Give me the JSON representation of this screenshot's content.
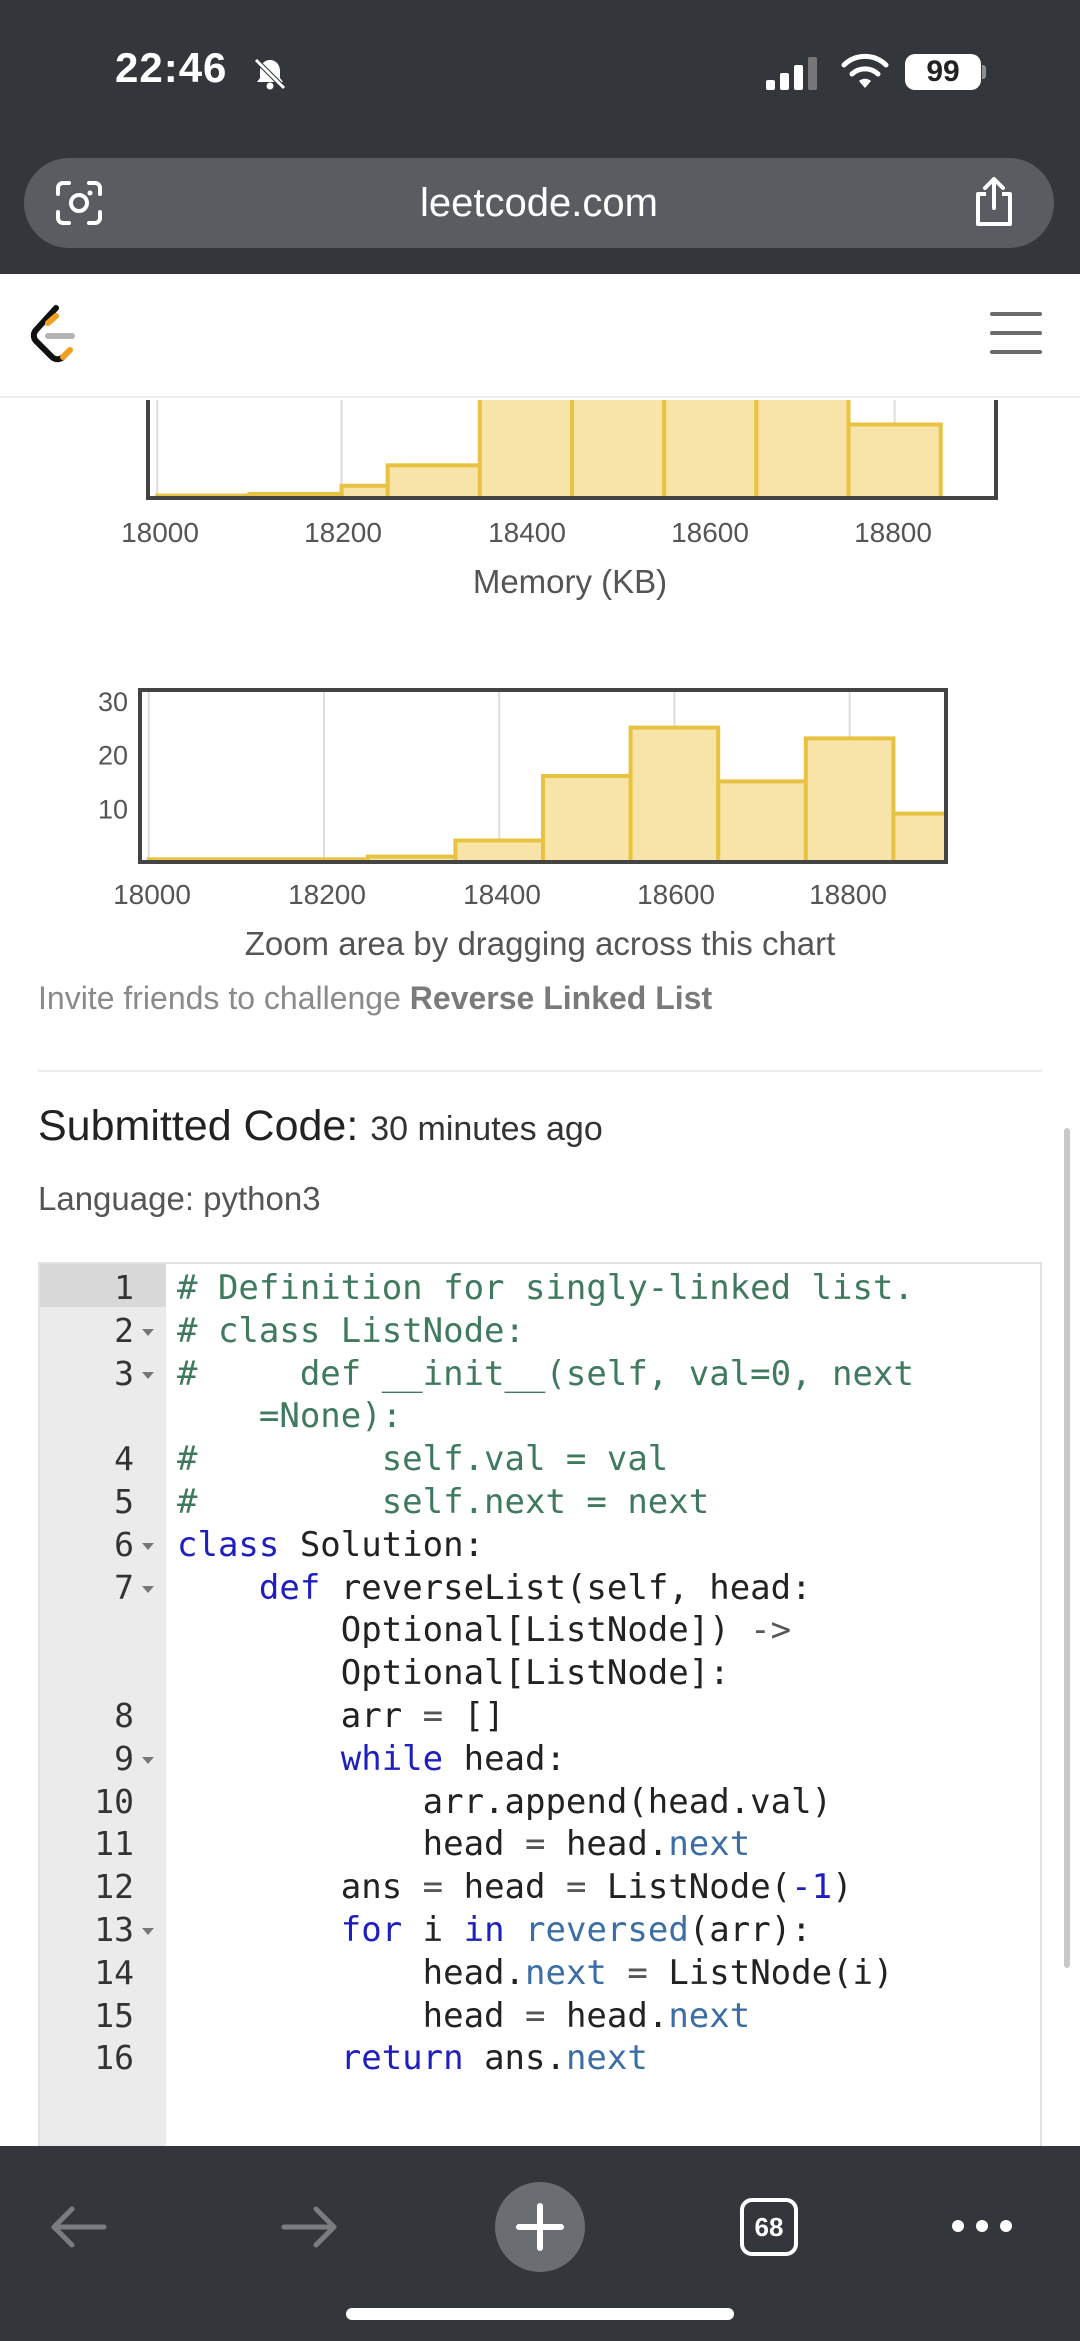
{
  "status_bar": {
    "time": "22:46",
    "battery": "99"
  },
  "browser": {
    "url": "leetcode.com",
    "tab_count": "68"
  },
  "memory_chart": {
    "xlabel": "Memory (KB)"
  },
  "zoom_chart": {
    "hint": "Zoom area by dragging across this chart"
  },
  "chart_data": [
    {
      "type": "bar",
      "x_ticks": [
        "18000",
        "18200",
        "18400",
        "18600",
        "18800"
      ],
      "xlabel": "Memory (KB)",
      "bins": [
        18000,
        18100,
        18200,
        18250,
        18350,
        18450,
        18550,
        18650,
        18750,
        18850,
        18900
      ],
      "values": [
        0.3,
        0.5,
        1.5,
        4,
        16,
        25,
        15,
        23,
        9
      ],
      "xlim": [
        17990,
        18910
      ],
      "note_cropped": true
    },
    {
      "type": "bar",
      "x_ticks": [
        "18000",
        "18200",
        "18400",
        "18600",
        "18800"
      ],
      "y_ticks": [
        "30",
        "20",
        "10"
      ],
      "bins": [
        18000,
        18250,
        18350,
        18450,
        18550,
        18650,
        18750,
        18850,
        18910
      ],
      "values": [
        0.5,
        1,
        4,
        16,
        25,
        15,
        23,
        9
      ],
      "xlim": [
        17990,
        18910
      ],
      "ylim": [
        0,
        32
      ]
    }
  ],
  "invite": {
    "prefix": "Invite friends to challenge ",
    "problem": "Reverse Linked List"
  },
  "submission": {
    "heading": "Submitted Code:",
    "ago": "30 minutes ago",
    "language": "Language: python3"
  },
  "code": {
    "line_numbers": [
      "1",
      "2",
      "3",
      "4",
      "5",
      "6",
      "7",
      "8",
      "9",
      "10",
      "11",
      "12",
      "13",
      "14",
      "15",
      "16"
    ],
    "lines": [
      "# Definition for singly-linked list.",
      "# class ListNode:",
      "#     def __init__(self, val=0, next",
      "    =None):",
      "#         self.val = val",
      "#         self.next = next",
      "class Solution:",
      "    def reverseList(self, head:",
      "        Optional[ListNode]) ->",
      "        Optional[ListNode]:",
      "        arr = []",
      "        while head:",
      "            arr.append(head.val)",
      "            head = head.next",
      "        ans = head = ListNode(-1)",
      "        for i in reversed(arr):",
      "            head.next = ListNode(i)",
      "            head = head.next",
      "        return ans.next"
    ]
  },
  "colors": {
    "bar_fill": "#f8e4a8",
    "bar_stroke": "#e8c240",
    "dark_chrome": "#33373b"
  }
}
